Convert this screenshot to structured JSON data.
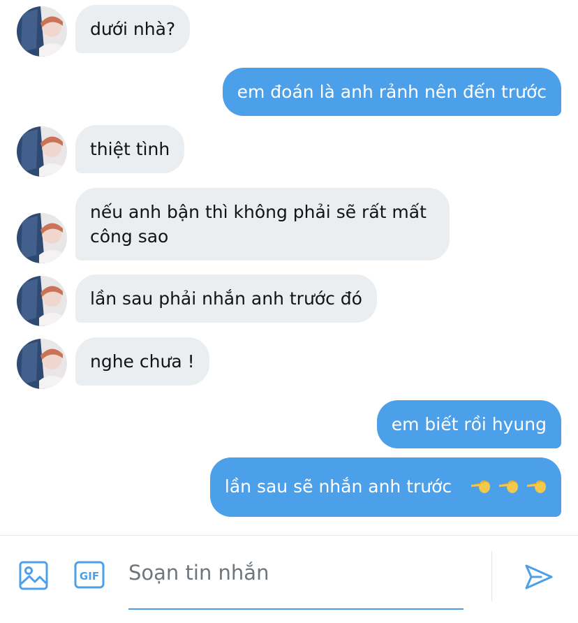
{
  "conversation": {
    "messages": [
      {
        "id": "m1",
        "direction": "received",
        "text": "dưới nhà?",
        "avatar": true
      },
      {
        "id": "m2",
        "direction": "sent",
        "text": "em đoán là anh rảnh nên đến trước"
      },
      {
        "id": "m3",
        "direction": "received",
        "text": "thiệt tình",
        "avatar": true
      },
      {
        "id": "m4",
        "direction": "received",
        "text": "nếu anh bận thì không phải sẽ rất mất công sao",
        "avatar": true
      },
      {
        "id": "m5",
        "direction": "received",
        "text": "lần sau phải nhắn anh trước đó",
        "avatar": true
      },
      {
        "id": "m6",
        "direction": "received",
        "text": "nghe chưa !",
        "avatar": true
      },
      {
        "id": "m7",
        "direction": "sent",
        "text": "em biết rồi hyung"
      },
      {
        "id": "m8",
        "direction": "sent",
        "text": "lần sau sẽ nhắn anh trước",
        "emojis": [
          "pointing-left-emoji",
          "pointing-left-emoji",
          "pointing-left-emoji"
        ]
      }
    ]
  },
  "composer": {
    "image_icon": "image-icon",
    "gif_icon_label": "GIF",
    "placeholder": "Soạn tin nhắn",
    "value": "",
    "send_icon": "send-icon"
  },
  "colors": {
    "sent_bubble": "#4c9fe9",
    "received_bubble": "#ebeef0",
    "accent": "#4c9fe9",
    "text_dark": "#0f1419",
    "placeholder": "#6e767d"
  }
}
